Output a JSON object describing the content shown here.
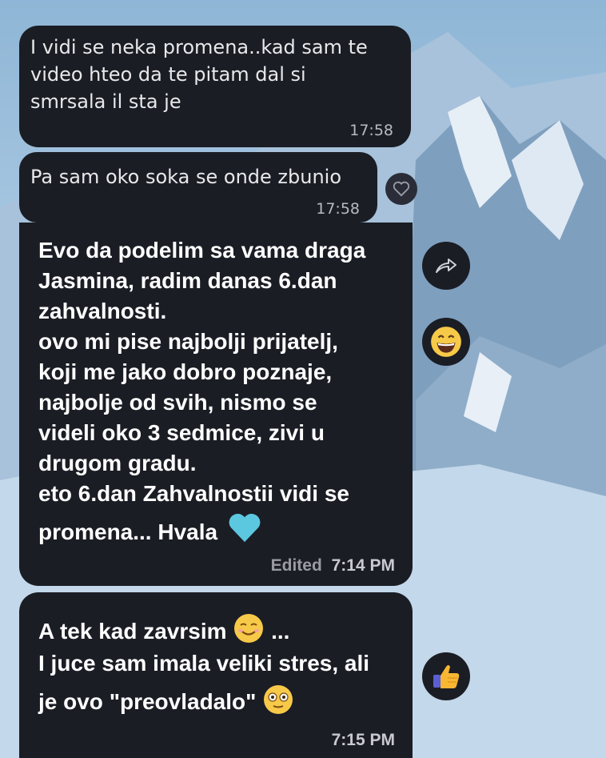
{
  "messages": {
    "quoted_1": {
      "text_lines": [
        "I vidi se neka promena..kad sam te",
        "video hteo da te pitam dal si",
        "smrsala il sta je"
      ],
      "time": "17:58"
    },
    "quoted_2": {
      "text": "Pa sam oko soka se onde zbunio",
      "time": "17:58"
    },
    "main": {
      "lines": [
        "Evo da podelim sa vama draga",
        "Jasmina, radim danas 6.dan",
        "zahvalnosti.",
        "ovo mi pise najbolji prijatelj,",
        "koji me jako dobro poznaje,",
        "najbolje od svih, nismo se",
        "videli oko 3 sedmice, zivi u",
        "drugom gradu.",
        "eto 6.dan Zahvalnostii vidi se",
        "promena... Hvala"
      ],
      "edited_label": "Edited",
      "time": "7:14 PM",
      "trailing_emoji": "blue-heart",
      "reaction": "grinning-face-emoji"
    },
    "second": {
      "line1": "A tek kad zavrsim",
      "line1_suffix": "...",
      "line2": "I juce sam imala veliki stres, ali",
      "line3": "je ovo \"preovladalo\"",
      "time": "7:15 PM",
      "reaction": "thumbs-up-emoji"
    }
  },
  "colors": {
    "bubble": "#1b1d25",
    "heart": "#5bc8e0",
    "emoji_yellow": "#f7c948"
  }
}
